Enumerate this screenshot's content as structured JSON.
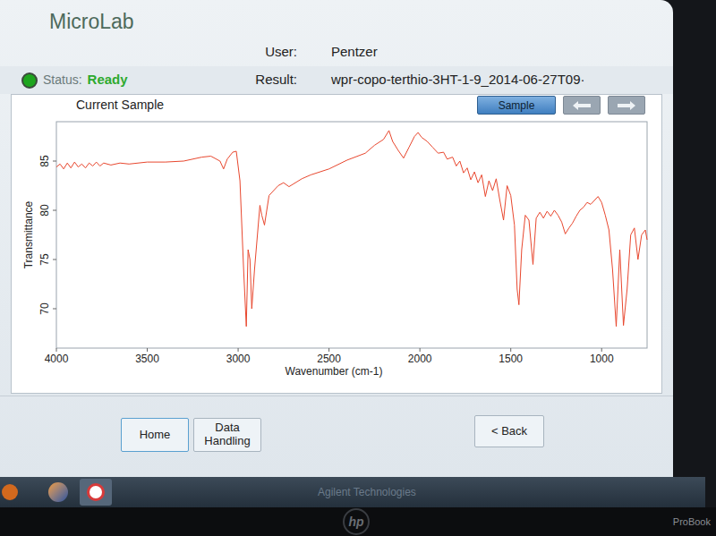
{
  "app": {
    "title": "MicroLab"
  },
  "user": {
    "label": "User:",
    "value": "Pentzer"
  },
  "status": {
    "label": "Status:",
    "value": "Ready"
  },
  "result": {
    "label": "Result:",
    "value": "wpr-copo-terthio-3HT-1-9_2014-06-27T09·"
  },
  "panel": {
    "title": "Current Sample",
    "view_buttons": [
      {
        "label": "Sample",
        "selected": true
      }
    ],
    "nav_buttons": [
      {
        "disabled": true
      },
      {
        "disabled": true
      }
    ]
  },
  "chart": {
    "y_axis": {
      "label": "Transmittance",
      "ticks": [
        "85",
        "80",
        "75",
        "70"
      ]
    },
    "x_axis": {
      "label": "Wavenumber (cm-1)",
      "ticks": [
        "4000",
        "3500",
        "3000",
        "2500",
        "2000",
        "1500",
        "1000"
      ]
    },
    "series": [
      {
        "name": "Current Sample",
        "x": [
          4000,
          3980,
          3960,
          3940,
          3920,
          3900,
          3880,
          3860,
          3840,
          3820,
          3800,
          3780,
          3760,
          3740,
          3700,
          3650,
          3600,
          3500,
          3400,
          3300,
          3200,
          3150,
          3100,
          3080,
          3060,
          3030,
          3010,
          2990,
          2970,
          2955,
          2945,
          2935,
          2925,
          2910,
          2880,
          2870,
          2855,
          2830,
          2780,
          2750,
          2720,
          2650,
          2600,
          2500,
          2400,
          2300,
          2250,
          2200,
          2170,
          2150,
          2120,
          2090,
          2060,
          2030,
          2010,
          1990,
          1960,
          1930,
          1900,
          1870,
          1850,
          1820,
          1800,
          1780,
          1760,
          1740,
          1720,
          1700,
          1680,
          1660,
          1640,
          1620,
          1600,
          1580,
          1560,
          1540,
          1520,
          1500,
          1480,
          1465,
          1455,
          1440,
          1420,
          1400,
          1378,
          1360,
          1340,
          1320,
          1300,
          1280,
          1260,
          1240,
          1220,
          1200,
          1180,
          1160,
          1140,
          1120,
          1100,
          1080,
          1060,
          1040,
          1020,
          1000,
          980,
          960,
          940,
          920,
          900,
          880,
          860,
          840,
          820,
          800,
          780,
          760,
          750
        ],
        "values": [
          84.4,
          84.7,
          84.2,
          84.8,
          84.3,
          84.9,
          84.4,
          84.7,
          84.3,
          84.8,
          84.5,
          84.9,
          84.5,
          84.8,
          84.6,
          84.8,
          84.7,
          84.9,
          84.9,
          85.0,
          85.4,
          85.5,
          85.0,
          84.2,
          85.2,
          85.9,
          86.0,
          83.0,
          74.0,
          68.2,
          76.0,
          75.0,
          70.0,
          74.0,
          80.5,
          79.5,
          78.5,
          81.5,
          82.5,
          82.8,
          82.4,
          83.2,
          83.6,
          84.2,
          85.1,
          85.8,
          86.6,
          87.2,
          88.1,
          87.0,
          86.1,
          85.3,
          86.4,
          87.5,
          87.9,
          87.4,
          87.0,
          86.4,
          85.8,
          85.9,
          85.2,
          85.4,
          84.5,
          85.0,
          83.8,
          84.3,
          83.1,
          83.9,
          82.8,
          83.6,
          81.4,
          83.0,
          82.0,
          83.2,
          81.0,
          79.0,
          82.5,
          81.5,
          78.5,
          72.0,
          70.4,
          76.0,
          79.5,
          79.0,
          74.5,
          79.2,
          79.8,
          79.2,
          79.9,
          79.4,
          80.0,
          79.5,
          78.8,
          77.6,
          78.2,
          78.7,
          79.4,
          80.0,
          80.3,
          80.8,
          80.6,
          81.0,
          81.4,
          80.8,
          79.5,
          78.0,
          74.0,
          68.2,
          76.0,
          68.3,
          72.0,
          77.5,
          78.2,
          75.0,
          77.5,
          78.0,
          77.0
        ]
      }
    ]
  },
  "footer_buttons": [
    {
      "label": "Home",
      "focused": true
    },
    {
      "label": "Data Handling",
      "focused": false
    },
    {
      "label": "< Back",
      "focused": false
    }
  ],
  "taskbar": {
    "watermark": "Agilent Technologies"
  },
  "laptop": {
    "brand": "hp",
    "model": "ProBook"
  }
}
